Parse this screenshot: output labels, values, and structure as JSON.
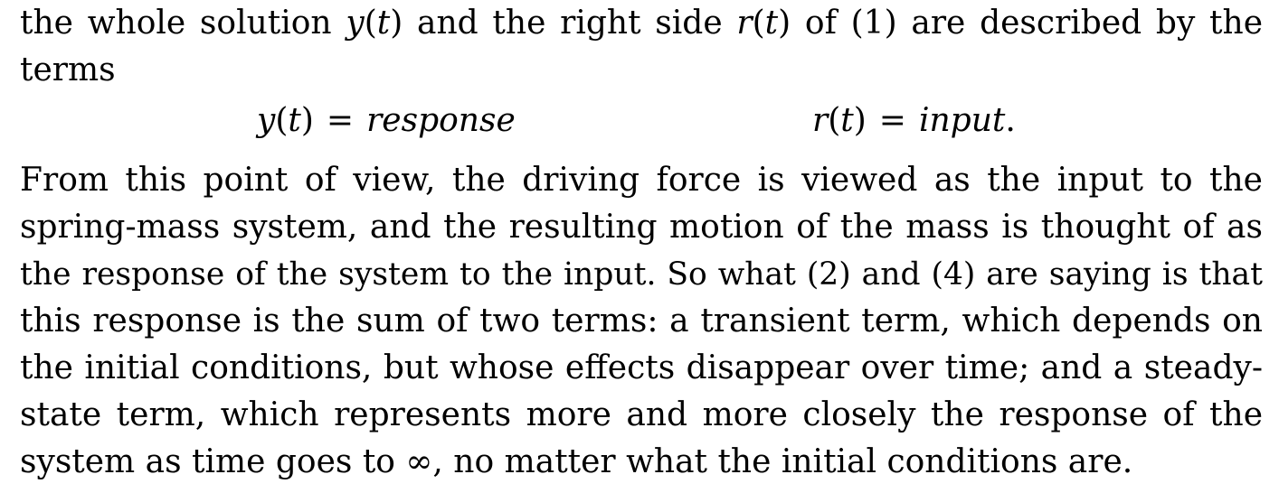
{
  "paragraph_intro": {
    "line1": {
      "t1": "the whole solution ",
      "y": "y",
      "po1": "(",
      "t": "t",
      "pc1": ")",
      "t2": " and the right side ",
      "r": "r",
      "po2": "(",
      "t_b": "t",
      "pc2": ")",
      "t3": " of (1) are described by the"
    },
    "line2": "terms"
  },
  "equations": {
    "left": {
      "var": "y",
      "open": "(",
      "arg": "t",
      "close": ")",
      "op": "=",
      "rhs": "response"
    },
    "right": {
      "var": "r",
      "open": "(",
      "arg": "t",
      "close": ")",
      "op": "=",
      "rhs": "input",
      "punct": "."
    }
  },
  "paragraph_main": {
    "lines": [
      "From this point of view, the driving force is viewed as the input to the",
      "spring-mass system, and the resulting motion of the mass is thought of as",
      "the response of the system to the input. So what (2) and (4) are saying is that",
      "this response is the sum of two terms: a transient term, which depends on",
      "the initial conditions, but whose effects disappear over time; and a steady-",
      "state term, which represents more and more closely the response of the",
      "system as time goes to ∞, no matter what the initial conditions are."
    ]
  }
}
